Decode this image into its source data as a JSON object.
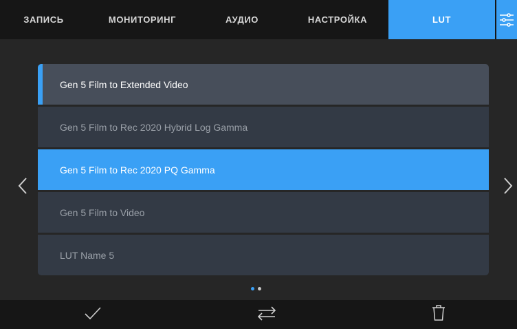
{
  "tabs": [
    {
      "label": "ЗАПИСЬ",
      "active": false
    },
    {
      "label": "МОНИТОРИНГ",
      "active": false
    },
    {
      "label": "АУДИО",
      "active": false
    },
    {
      "label": "НАСТРОЙКА",
      "active": false
    },
    {
      "label": "LUT",
      "active": true
    }
  ],
  "menu_icon": "sliders-icon",
  "lut_list": {
    "items": [
      {
        "label": "Gen 5 Film to Extended Video",
        "state": "loaded"
      },
      {
        "label": "Gen 5 Film to Rec 2020 Hybrid Log Gamma",
        "state": "normal"
      },
      {
        "label": "Gen 5 Film to Rec 2020 PQ Gamma",
        "state": "selected"
      },
      {
        "label": "Gen 5 Film to Video",
        "state": "normal"
      },
      {
        "label": "LUT Name 5",
        "state": "normal"
      }
    ]
  },
  "navigation": {
    "prev_icon": "chevron-left-icon",
    "next_icon": "chevron-right-icon",
    "page_dots": {
      "total": 2,
      "current": 1
    }
  },
  "toolbar": {
    "confirm_icon": "checkmark-icon",
    "transfer_icon": "swap-arrows-icon",
    "delete_icon": "trash-icon"
  },
  "colors": {
    "accent": "#3aa0f5",
    "bar_background": "#161616",
    "screen_background": "#262626",
    "row_background": "#333a45",
    "row_active_background": "#474e5a"
  }
}
